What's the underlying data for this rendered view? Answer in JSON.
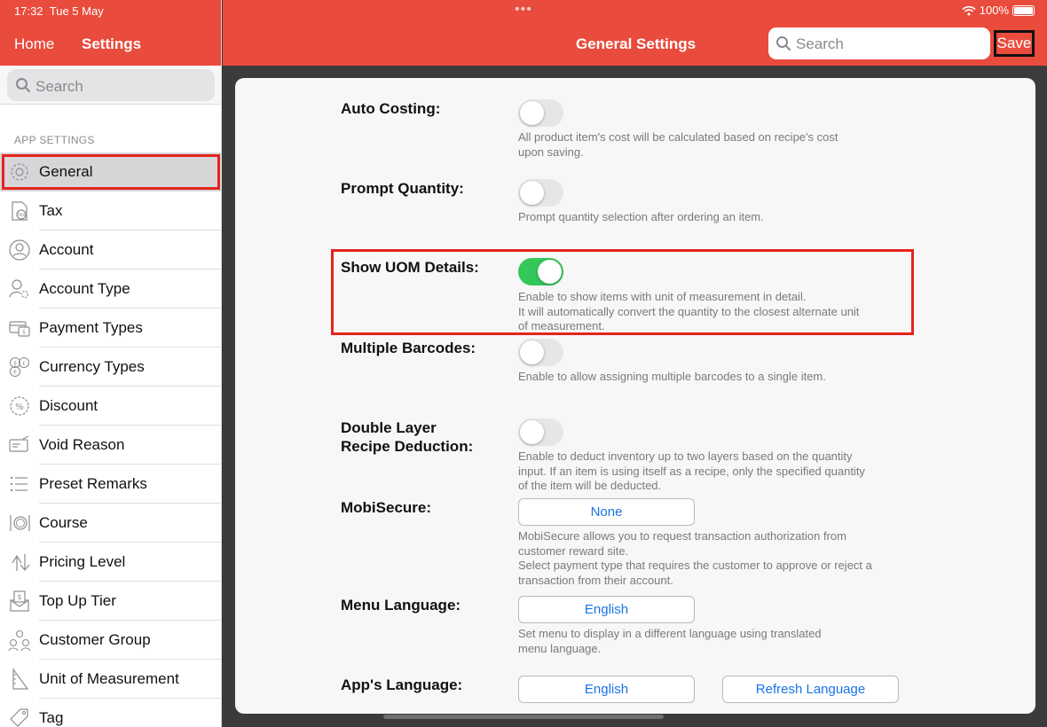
{
  "status": {
    "time": "17:32",
    "date": "Tue 5 May",
    "battery": "100%"
  },
  "left": {
    "home_label": "Home",
    "title": "Settings",
    "search_placeholder": "Search",
    "section_header": "APP SETTINGS",
    "items": [
      {
        "label": "General",
        "icon": "gear-icon"
      },
      {
        "label": "Tax",
        "icon": "tax-icon"
      },
      {
        "label": "Account",
        "icon": "user-icon"
      },
      {
        "label": "Account Type",
        "icon": "user-gear-icon"
      },
      {
        "label": "Payment Types",
        "icon": "payment-icon"
      },
      {
        "label": "Currency Types",
        "icon": "currency-icon"
      },
      {
        "label": "Discount",
        "icon": "discount-icon"
      },
      {
        "label": "Void Reason",
        "icon": "void-icon"
      },
      {
        "label": "Preset Remarks",
        "icon": "list-icon"
      },
      {
        "label": "Course",
        "icon": "cutlery-icon"
      },
      {
        "label": "Pricing Level",
        "icon": "pricing-icon"
      },
      {
        "label": "Top Up Tier",
        "icon": "topup-icon"
      },
      {
        "label": "Customer Group",
        "icon": "group-icon"
      },
      {
        "label": "Unit of Measurement",
        "icon": "ruler-icon"
      },
      {
        "label": "Tag",
        "icon": "tag-icon"
      }
    ]
  },
  "header": {
    "title": "General Settings",
    "search_placeholder": "Search",
    "save_label": "Save"
  },
  "settings": {
    "auto_costing": {
      "label": "Auto Costing:",
      "enabled": false,
      "desc": [
        "All product item's cost will be calculated based on recipe's cost",
        "upon saving."
      ]
    },
    "prompt_quantity": {
      "label": "Prompt Quantity:",
      "enabled": false,
      "desc": [
        "Prompt quantity selection after ordering an item."
      ]
    },
    "show_uom": {
      "label": "Show UOM Details:",
      "enabled": true,
      "desc": [
        "Enable to show items with unit of measurement in detail.",
        "It will automatically convert the quantity to the closest alternate unit",
        "of measurement."
      ]
    },
    "multiple_barcodes": {
      "label": "Multiple Barcodes:",
      "enabled": false,
      "desc": [
        "Enable to allow assigning multiple barcodes to a single item."
      ]
    },
    "double_layer": {
      "label": [
        "Double Layer",
        "Recipe Deduction:"
      ],
      "enabled": false,
      "desc": [
        "Enable to deduct inventory up to two layers based on the quantity",
        "input. If an item is using itself as a recipe, only the specified quantity",
        "of the item will be deducted."
      ]
    },
    "mobisecure": {
      "label": "MobiSecure:",
      "value": "None",
      "desc": [
        "MobiSecure allows you to request transaction authorization from",
        "customer reward site.",
        "Select payment type that requires the customer to approve or reject a",
        "transaction from their account."
      ]
    },
    "menu_language": {
      "label": "Menu Language:",
      "value": "English",
      "desc": [
        "Set menu to display in a different language using translated",
        "menu language."
      ]
    },
    "app_language": {
      "label": "App's Language:",
      "value": "English",
      "refresh_label": "Refresh Language"
    }
  },
  "colors": {
    "brand": "#e94b3c",
    "toggle_on": "#34c759",
    "highlight": "#e5231c",
    "link": "#1a73e8"
  }
}
